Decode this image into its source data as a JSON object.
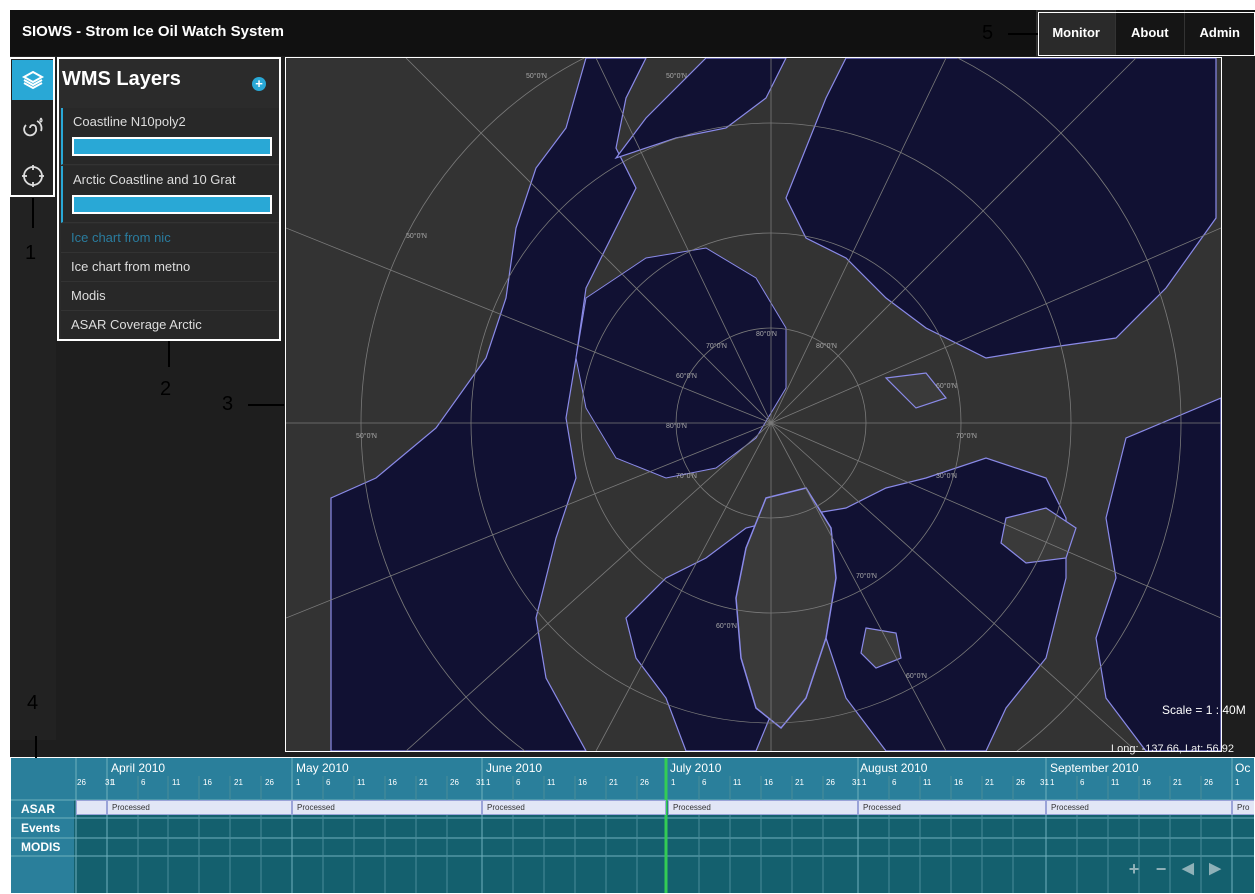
{
  "app": {
    "title": "SIOWS - Strom Ice Oil Watch System"
  },
  "nav": [
    "Monitor",
    "About",
    "Admin"
  ],
  "rail": [
    "layers-icon",
    "storm-icon",
    "crosshair-icon"
  ],
  "layers_panel": {
    "title": "WMS Layers",
    "add_label": "+",
    "items": [
      {
        "label": "Coastline N10poly2",
        "opacity": 1.0
      },
      {
        "label": "Arctic Coastline and 10 Grat",
        "opacity": 1.0
      },
      {
        "label": "Ice chart from nic"
      },
      {
        "label": "Ice chart from metno"
      },
      {
        "label": "Modis"
      },
      {
        "label": "ASAR Coverage Arctic"
      }
    ]
  },
  "map": {
    "scale": "Scale = 1 : 40M",
    "coords": "Long: -137.66, Lat: 56.92",
    "grat_labels": [
      "80°0'N",
      "70°0'N",
      "60°0'N",
      "50°0'N",
      "80°0'N",
      "70°0'N",
      "60°0'N",
      "50°0'N",
      "30°0'N",
      "70°0'N",
      "80°0'N",
      "60°0'N",
      "70°0'N",
      "50°0'N",
      "50°0'N",
      "60°0'N"
    ],
    "colors": {
      "ocean": "#111133",
      "land": "#3a3a3a",
      "coast": "#8a8ae8",
      "grid": "#7a7a7a"
    }
  },
  "timeline": {
    "months": [
      "April 2010",
      "May 2010",
      "June 2010",
      "July 2010",
      "August 2010",
      "September 2010",
      "Oc"
    ],
    "days": [
      "26",
      "31",
      "1",
      "6",
      "11",
      "16",
      "21",
      "26",
      "1",
      "6",
      "11",
      "16",
      "21",
      "26",
      "31",
      "1",
      "6",
      "11",
      "16",
      "21",
      "26",
      "1",
      "6",
      "11",
      "16",
      "21",
      "26",
      "31",
      "1",
      "6",
      "11",
      "16",
      "21",
      "26",
      "31",
      "1",
      "6",
      "11",
      "16",
      "21",
      "26",
      "1"
    ],
    "rows": [
      "ASAR",
      "Events",
      "MODIS"
    ],
    "processed": [
      "Processed",
      "Processed",
      "Processed",
      "Processed",
      "Processed",
      "Processed",
      "Pro"
    ],
    "controls": [
      "+",
      "−",
      "◀",
      "▶"
    ]
  },
  "annotations": [
    "1",
    "2",
    "3",
    "4",
    "5"
  ]
}
